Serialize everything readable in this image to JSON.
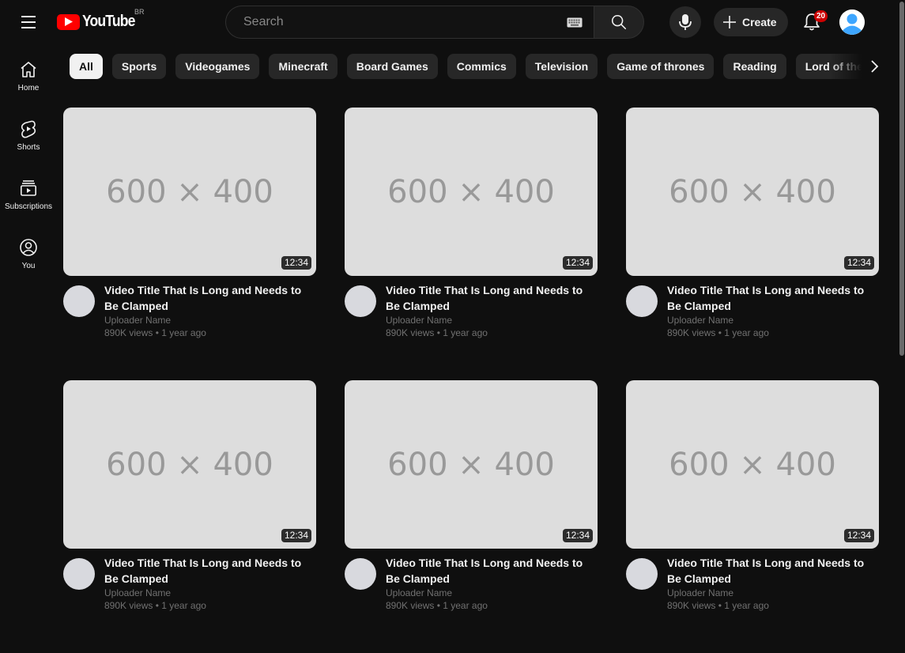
{
  "header": {
    "logo_text": "YouTube",
    "country_code": "BR",
    "search_placeholder": "Search",
    "create_label": "Create",
    "notification_count": "20"
  },
  "sidebar": {
    "items": [
      {
        "label": "Home",
        "icon": "home-icon"
      },
      {
        "label": "Shorts",
        "icon": "shorts-icon"
      },
      {
        "label": "Subscriptions",
        "icon": "subscriptions-icon"
      },
      {
        "label": "You",
        "icon": "you-icon"
      }
    ]
  },
  "chips": [
    "All",
    "Sports",
    "Videogames",
    "Minecraft",
    "Board Games",
    "Commics",
    "Television",
    "Game of thrones",
    "Reading",
    "Lord of the rings"
  ],
  "active_chip": "All",
  "videos": [
    {
      "thumbnail": "600 × 400",
      "duration": "12:34",
      "title": "Video Title That Is Long and Needs to Be Clamped",
      "uploader": "Uploader Name",
      "stats": "890K views • 1 year ago"
    },
    {
      "thumbnail": "600 × 400",
      "duration": "12:34",
      "title": "Video Title That Is Long and Needs to Be Clamped",
      "uploader": "Uploader Name",
      "stats": "890K views • 1 year ago"
    },
    {
      "thumbnail": "600 × 400",
      "duration": "12:34",
      "title": "Video Title That Is Long and Needs to Be Clamped",
      "uploader": "Uploader Name",
      "stats": "890K views • 1 year ago"
    },
    {
      "thumbnail": "600 × 400",
      "duration": "12:34",
      "title": "Video Title That Is Long and Needs to Be Clamped",
      "uploader": "Uploader Name",
      "stats": "890K views • 1 year ago"
    },
    {
      "thumbnail": "600 × 400",
      "duration": "12:34",
      "title": "Video Title That Is Long and Needs to Be Clamped",
      "uploader": "Uploader Name",
      "stats": "890K views • 1 year ago"
    },
    {
      "thumbnail": "600 × 400",
      "duration": "12:34",
      "title": "Video Title That Is Long and Needs to Be Clamped",
      "uploader": "Uploader Name",
      "stats": "890K views • 1 year ago"
    }
  ],
  "colors": {
    "background": "#0f0f0f",
    "brand_red": "#ff0000",
    "badge_red": "#cc0000",
    "chip_bg": "#272727",
    "chip_active_bg": "#f1f1f1",
    "avatar_blue": "#3ea6ff"
  }
}
